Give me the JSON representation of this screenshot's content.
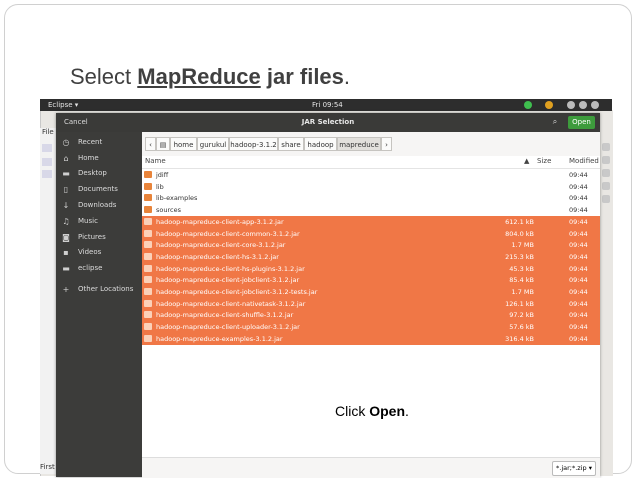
{
  "slide": {
    "title_prefix": "Select ",
    "title_underlined": "MapReduce",
    "title_bold": " jar files",
    "title_suffix": ".",
    "caption_prefix": "Click ",
    "caption_bold": "Open",
    "caption_suffix": "."
  },
  "topbar": {
    "app_label": "Eclipse ▾",
    "clock": "Fri 09:54"
  },
  "background": {
    "menu_file": "File",
    "bottom_text": "First"
  },
  "dialog": {
    "title": "JAR Selection",
    "cancel_label": "Cancel",
    "open_label": "Open",
    "search_icon": "⌕",
    "accent_color": "#f07746",
    "open_color": "#3d9b3c",
    "sidebar": [
      {
        "icon": "clock-icon",
        "glyph": "◷",
        "label": "Recent"
      },
      {
        "icon": "home-icon",
        "glyph": "⌂",
        "label": "Home"
      },
      {
        "icon": "folder-icon",
        "glyph": "▬",
        "label": "Desktop"
      },
      {
        "icon": "document-icon",
        "glyph": "▯",
        "label": "Documents"
      },
      {
        "icon": "download-icon",
        "glyph": "↓",
        "label": "Downloads"
      },
      {
        "icon": "music-icon",
        "glyph": "♫",
        "label": "Music"
      },
      {
        "icon": "camera-icon",
        "glyph": "◙",
        "label": "Pictures"
      },
      {
        "icon": "video-icon",
        "glyph": "▪",
        "label": "Videos"
      },
      {
        "icon": "folder-icon",
        "glyph": "▬",
        "label": "eclipse"
      },
      {
        "icon": "plus-icon",
        "glyph": "+",
        "label": "Other Locations"
      }
    ],
    "path": [
      "home",
      "gurukul",
      "hadoop-3.1.2",
      "share",
      "hadoop",
      "mapreduce"
    ],
    "path_active": "mapreduce",
    "columns": {
      "name": "Name",
      "size": "Size",
      "modified": "Modified"
    },
    "files": [
      {
        "name": "jdiff",
        "size": "",
        "modified": "09:44",
        "type": "folder",
        "selected": false
      },
      {
        "name": "lib",
        "size": "",
        "modified": "09:44",
        "type": "folder",
        "selected": false
      },
      {
        "name": "lib-examples",
        "size": "",
        "modified": "09:44",
        "type": "folder",
        "selected": false
      },
      {
        "name": "sources",
        "size": "",
        "modified": "09:44",
        "type": "folder",
        "selected": false
      },
      {
        "name": "hadoop-mapreduce-client-app-3.1.2.jar",
        "size": "612.1 kB",
        "modified": "09:44",
        "type": "jar",
        "selected": true
      },
      {
        "name": "hadoop-mapreduce-client-common-3.1.2.jar",
        "size": "804.0 kB",
        "modified": "09:44",
        "type": "jar",
        "selected": true
      },
      {
        "name": "hadoop-mapreduce-client-core-3.1.2.jar",
        "size": "1.7 MB",
        "modified": "09:44",
        "type": "jar",
        "selected": true
      },
      {
        "name": "hadoop-mapreduce-client-hs-3.1.2.jar",
        "size": "215.3 kB",
        "modified": "09:44",
        "type": "jar",
        "selected": true
      },
      {
        "name": "hadoop-mapreduce-client-hs-plugins-3.1.2.jar",
        "size": "45.3 kB",
        "modified": "09:44",
        "type": "jar",
        "selected": true
      },
      {
        "name": "hadoop-mapreduce-client-jobclient-3.1.2.jar",
        "size": "85.4 kB",
        "modified": "09:44",
        "type": "jar",
        "selected": true
      },
      {
        "name": "hadoop-mapreduce-client-jobclient-3.1.2-tests.jar",
        "size": "1.7 MB",
        "modified": "09:44",
        "type": "jar",
        "selected": true
      },
      {
        "name": "hadoop-mapreduce-client-nativetask-3.1.2.jar",
        "size": "126.1 kB",
        "modified": "09:44",
        "type": "jar",
        "selected": true
      },
      {
        "name": "hadoop-mapreduce-client-shuffle-3.1.2.jar",
        "size": "97.2 kB",
        "modified": "09:44",
        "type": "jar",
        "selected": true
      },
      {
        "name": "hadoop-mapreduce-client-uploader-3.1.2.jar",
        "size": "57.6 kB",
        "modified": "09:44",
        "type": "jar",
        "selected": true
      },
      {
        "name": "hadoop-mapreduce-examples-3.1.2.jar",
        "size": "316.4 kB",
        "modified": "09:44",
        "type": "jar",
        "selected": true
      }
    ],
    "filter": "*.jar;*.zip ▾"
  }
}
